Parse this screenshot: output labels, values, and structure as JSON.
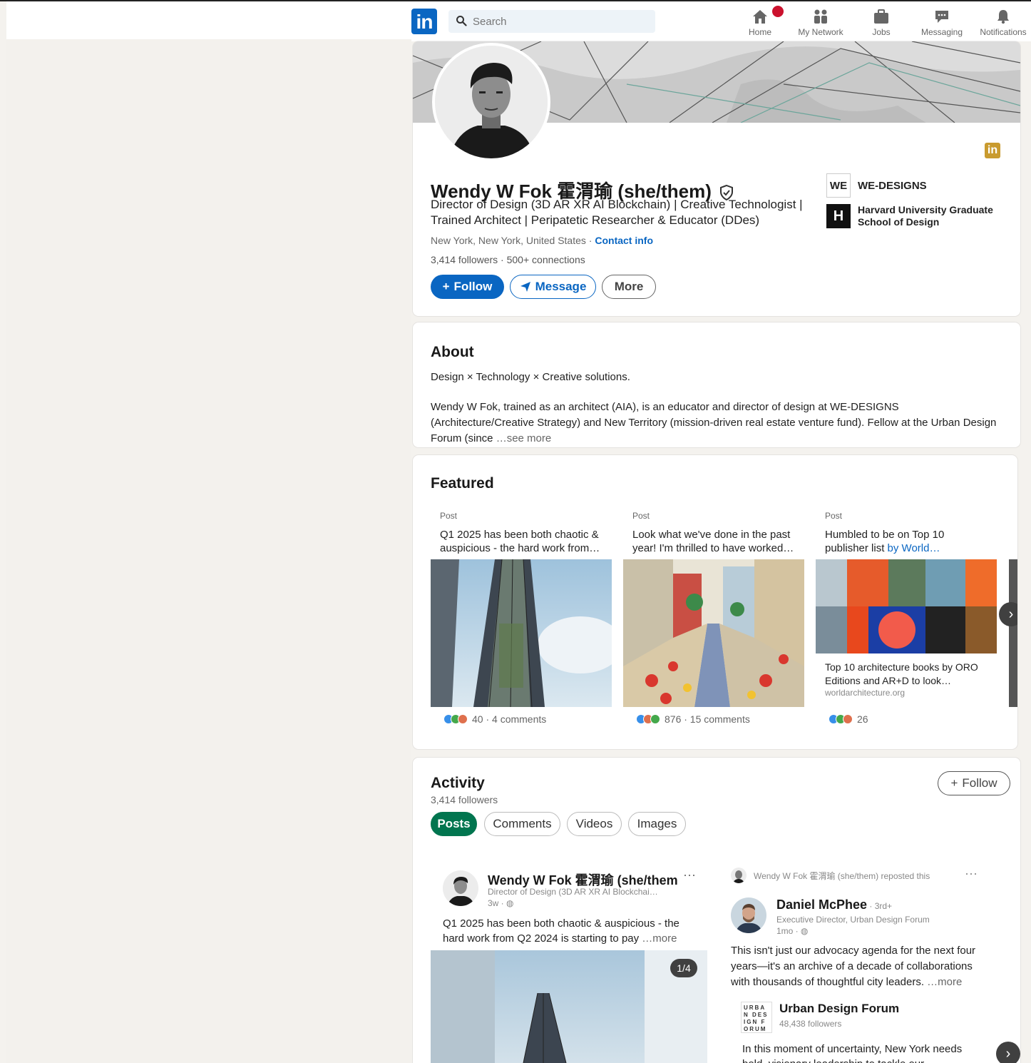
{
  "nav": {
    "search_placeholder": "Search",
    "items": [
      {
        "label": "Home",
        "icon": "home-icon"
      },
      {
        "label": "My Network",
        "icon": "network-icon"
      },
      {
        "label": "Jobs",
        "icon": "briefcase-icon"
      },
      {
        "label": "Messaging",
        "icon": "messaging-icon"
      },
      {
        "label": "Notifications",
        "icon": "bell-icon"
      }
    ]
  },
  "profile": {
    "name": "Wendy W Fok 霍渭瑜 (she/them)",
    "headline": "Director of Design (3D AR XR AI Blockchain) | Creative Technologist | Trained Architect | Peripatetic Researcher & Educator (DDes)",
    "location": "New York, New York, United States",
    "location_sep": " · ",
    "contact_info": "Contact info",
    "followers": "3,414 followers",
    "connections": " · 500+ connections",
    "follow_label": "Follow",
    "message_label": "Message",
    "more_label": "More",
    "orgs": [
      {
        "logo_text": "WE",
        "name": "WE-DESIGNS"
      },
      {
        "logo_text": "H",
        "name": "Harvard University Graduate School of Design"
      }
    ]
  },
  "about": {
    "title": "About",
    "tagline": "Design × Technology × Creative solutions.",
    "text": "Wendy W Fok, trained as an architect (AIA), is an educator and director of design at WE-DESIGNS (Architecture/Creative Strategy) and New Territory (mission-driven real estate venture fund). Fellow at the Urban Design Forum (since",
    "see_more": " …see more"
  },
  "featured": {
    "title": "Featured",
    "items": [
      {
        "type": "Post",
        "text": "Q1 2025 has been both chaotic & auspicious - the hard work from…",
        "reactions": "40 · 4 comments"
      },
      {
        "type": "Post",
        "text": "Look what we've done in the past year! I'm thrilled to have worked…",
        "reactions": "876 · 15 comments"
      },
      {
        "type": "Post",
        "text_a": "Humbled to be on Top 10 publisher list ",
        "text_link": "by World…",
        "link_title": "Top 10 architecture books by ORO Editions and AR+D to look…",
        "link_domain": "worldarchitecture.org",
        "reactions": "26"
      }
    ]
  },
  "activity": {
    "title": "Activity",
    "followers": "3,414 followers",
    "follow_label": "Follow",
    "tabs": [
      "Posts",
      "Comments",
      "Videos",
      "Images"
    ],
    "post1": {
      "author": "Wendy W Fok 霍渭瑜 (she/them",
      "sub": "Director of Design (3D AR XR AI Blockchai…",
      "time": "3w · ",
      "text": "Q1 2025 has been both chaotic & auspicious - the hard work from Q2 2024 is starting to pay",
      "more": " …more",
      "counter": "1/4"
    },
    "post2": {
      "repost": "Wendy W Fok 霍渭瑜 (she/them) reposted this",
      "author": "Daniel McPhee",
      "degree": " · 3rd+",
      "sub": "Executive Director, Urban Design Forum",
      "time": "1mo · ",
      "text": "This isn't just our advocacy agenda for the next four years—it's an archive of a decade of collaborations with thousands of thoughtful city leaders.",
      "more": " …more",
      "org_name": "Urban Design Forum",
      "org_logo": "URBAN DESIGN FORUM",
      "org_followers": "48,438 followers",
      "org_text": "In this moment of uncertainty, New York needs bold, visionary leadership to tackle our challenges"
    }
  }
}
